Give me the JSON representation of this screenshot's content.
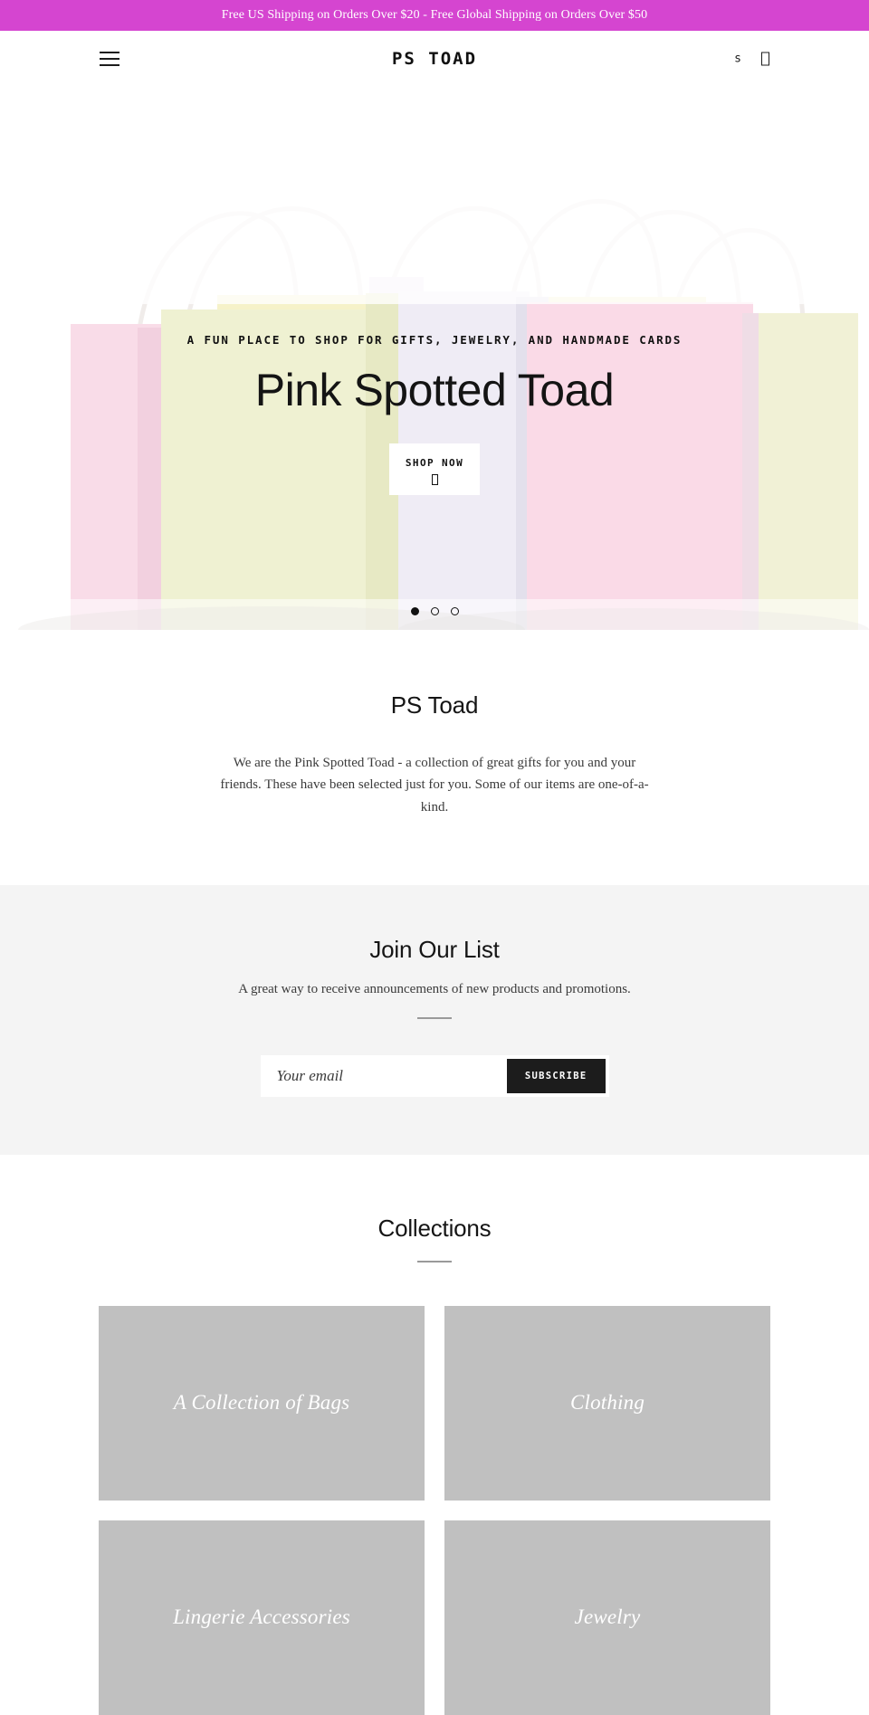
{
  "announcement": {
    "text": "Free US Shipping on Orders Over $20 - Free Global Shipping on Orders Over $50",
    "bg_color": "#d545d0",
    "text_color": "#ffffff"
  },
  "header": {
    "menu_icon": "hamburger-menu-icon",
    "logo": "PS TOAD",
    "search_icon_label": "s",
    "cart_icon_label": "□"
  },
  "hero": {
    "eyebrow": "A FUN PLACE TO SHOP FOR GIFTS, JEWELRY, AND HANDMADE CARDS",
    "title": "Pink Spotted Toad",
    "button_label": "SHOP NOW",
    "button_sub_glyph": "□",
    "slides_total": 3,
    "active_slide": 1,
    "image_description": "pastel colored paper gift bags with twisted handles",
    "bag_colors": [
      "#f7dce8",
      "#eef0cf",
      "#ece8f2",
      "#fadbe6",
      "#f0f0d2",
      "#f6d7e4"
    ]
  },
  "intro": {
    "title": "PS Toad",
    "body": "We are the Pink Spotted Toad - a collection of great gifts for you and your friends.  These have been selected just for you.  Some of our items are one-of-a-kind."
  },
  "newsletter": {
    "title": "Join Our List",
    "subtitle": "A great way to receive announcements of new products and promotions.",
    "email_placeholder": "Your email",
    "email_value": "",
    "submit_label": "SUBSCRIBE",
    "bg_color": "#f4f4f4"
  },
  "collections": {
    "title": "Collections",
    "cards": [
      {
        "label": "A Collection of Bags"
      },
      {
        "label": "Clothing"
      },
      {
        "label": "Lingerie Accessories"
      },
      {
        "label": "Jewelry"
      }
    ],
    "placeholder_color": "#c0c0c0"
  }
}
